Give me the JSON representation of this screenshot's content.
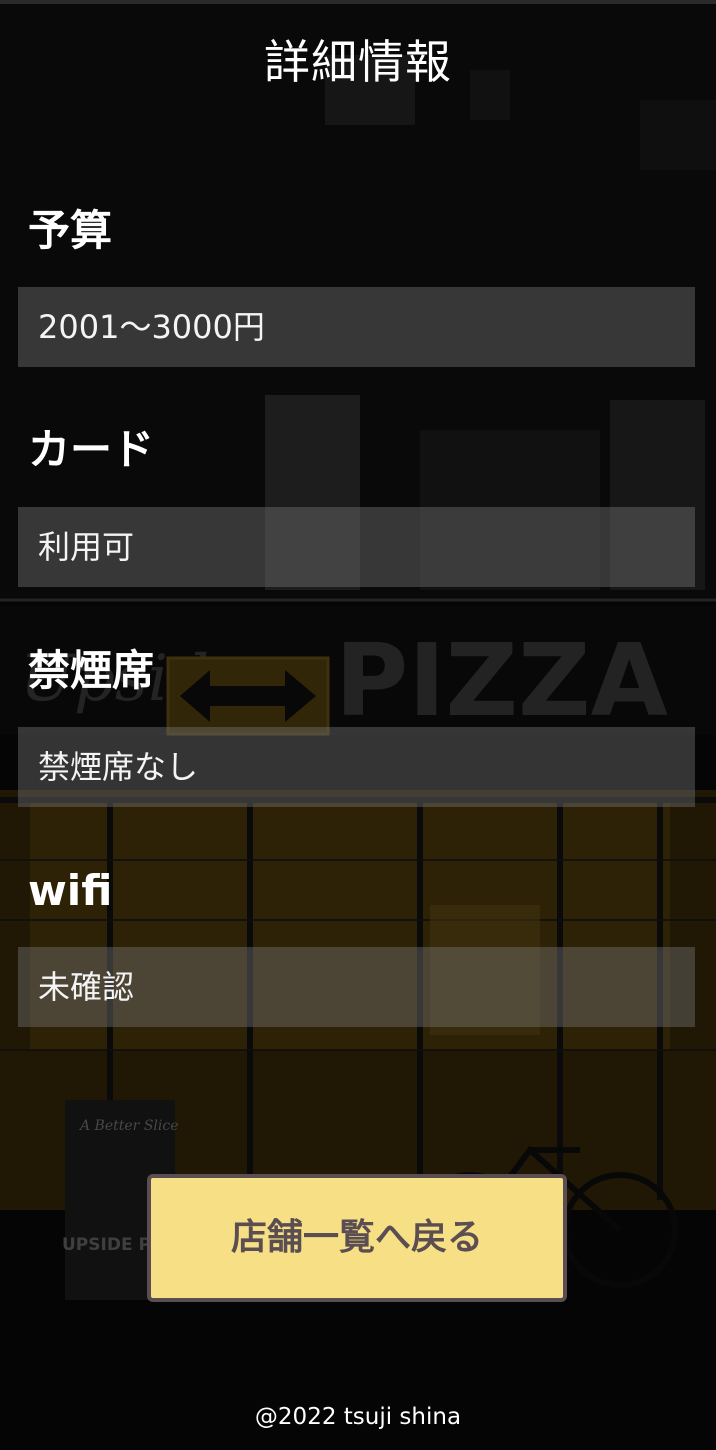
{
  "header": {
    "title": "詳細情報"
  },
  "details": [
    {
      "label": "予算",
      "value": "2001～3000円"
    },
    {
      "label": "カード",
      "value": "利用可"
    },
    {
      "label": "禁煙席",
      "value": "禁煙席なし"
    },
    {
      "label": "wifi",
      "value": "未確認"
    }
  ],
  "background": {
    "sign_text": "PIZZA",
    "sign_script": "Upside",
    "small_sign_text": "A Better Slice",
    "board_text": "UPSIDE PIZZA",
    "accent_color": "#f6df84",
    "storefront_glow": "#7a5a1a"
  },
  "actions": {
    "back_label": "店舗一覧へ戻る"
  },
  "footer": {
    "copyright": "@2022 tsuji shina"
  }
}
